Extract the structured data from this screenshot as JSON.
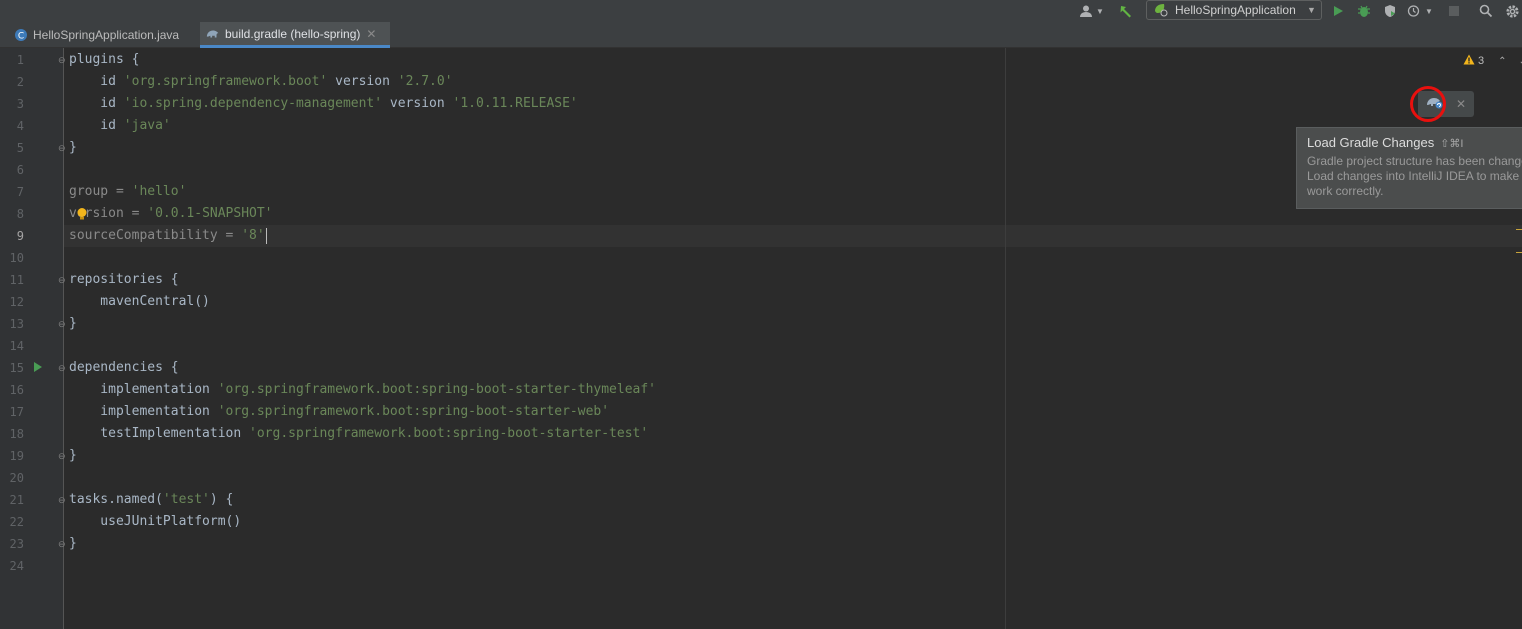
{
  "toolbar": {
    "run_config": "HelloSpringApplication"
  },
  "tabs": [
    {
      "label": "HelloSpringApplication.java",
      "active": false
    },
    {
      "label": "build.gradle (hello-spring)",
      "active": true
    }
  ],
  "editor": {
    "line_numbers": [
      "1",
      "2",
      "3",
      "4",
      "5",
      "6",
      "7",
      "8",
      "9",
      "10",
      "11",
      "12",
      "13",
      "14",
      "15",
      "16",
      "17",
      "18",
      "19",
      "20",
      "21",
      "22",
      "23",
      "24"
    ],
    "current_line": "9",
    "warnings_count": "3",
    "code": {
      "l1_kw": "plugins {",
      "l2_a": "    id ",
      "l2_b": "'org.springframework.boot'",
      "l2_c": " version ",
      "l2_d": "'2.7.0'",
      "l3_a": "    id ",
      "l3_b": "'io.spring.dependency-management'",
      "l3_c": " version ",
      "l3_d": "'1.0.11.RELEASE'",
      "l4_a": "    id ",
      "l4_b": "'java'",
      "l5": "}",
      "l7_a": "group = ",
      "l7_b": "'hello'",
      "l8_a": "version = ",
      "l8_b": "'0.0.1-SNAPSHOT'",
      "l9_a": "sourceCompatibility = ",
      "l9_b": "'8'",
      "l11": "repositories {",
      "l12": "    mavenCentral()",
      "l13": "}",
      "l15": "dependencies {",
      "l16_a": "    implementation ",
      "l16_b": "'org.springframework.boot:spring-boot-starter-thymeleaf'",
      "l17_a": "    implementation ",
      "l17_b": "'org.springframework.boot:spring-boot-starter-web'",
      "l18_a": "    testImplementation ",
      "l18_b": "'org.springframework.boot:spring-boot-starter-test'",
      "l19": "}",
      "l21_a": "tasks.named(",
      "l21_b": "'test'",
      "l21_c": ") {",
      "l22": "    useJUnitPlatform()",
      "l23": "}"
    }
  },
  "tooltip": {
    "title": "Load Gradle Changes",
    "shortcut": "⇧⌘I",
    "description": "Gradle project structure has been changed.\nLoad changes into IntelliJ IDEA to make it\nwork correctly."
  },
  "colors": {
    "accent": "#4a88c7",
    "highlight_ring": "#e8100e",
    "string": "#6a8759",
    "run_green": "#499c54"
  }
}
